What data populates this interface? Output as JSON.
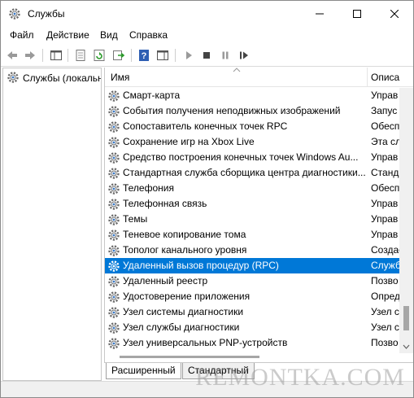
{
  "window": {
    "title": "Службы"
  },
  "menu": [
    "Файл",
    "Действие",
    "Вид",
    "Справка"
  ],
  "tree": {
    "root_label": "Службы (локальн"
  },
  "columns": {
    "name": "Имя",
    "description": "Описа"
  },
  "services": [
    {
      "name": "Смарт-карта",
      "desc": "Управ"
    },
    {
      "name": "События получения неподвижных изображений",
      "desc": "Запус"
    },
    {
      "name": "Сопоставитель конечных точек RPC",
      "desc": "Обесп"
    },
    {
      "name": "Сохранение игр на Xbox Live",
      "desc": "Эта сл"
    },
    {
      "name": "Средство построения конечных точек Windows Au...",
      "desc": "Управ"
    },
    {
      "name": "Стандартная служба сборщика центра диагностики...",
      "desc": "Станда"
    },
    {
      "name": "Телефония",
      "desc": "Обесп"
    },
    {
      "name": "Телефонная связь",
      "desc": "Управ"
    },
    {
      "name": "Темы",
      "desc": "Управ"
    },
    {
      "name": "Теневое копирование тома",
      "desc": "Управ"
    },
    {
      "name": "Тополог канального уровня",
      "desc": "Создае"
    },
    {
      "name": "Удаленный вызов процедур (RPC)",
      "desc": "Служб"
    },
    {
      "name": "Удаленный реестр",
      "desc": "Позво"
    },
    {
      "name": "Удостоверение приложения",
      "desc": "Опред"
    },
    {
      "name": "Узел системы диагностики",
      "desc": "Узел с"
    },
    {
      "name": "Узел службы диагностики",
      "desc": "Узел с"
    },
    {
      "name": "Узел универсальных PNP-устройств",
      "desc": "Позво"
    }
  ],
  "selected_service_index": 11,
  "tabs": [
    "Расширенный",
    "Стандартный"
  ],
  "watermark": "REMONTKA.COM",
  "colors": {
    "selection": "#0078d7",
    "gear": "#3b78c2"
  }
}
